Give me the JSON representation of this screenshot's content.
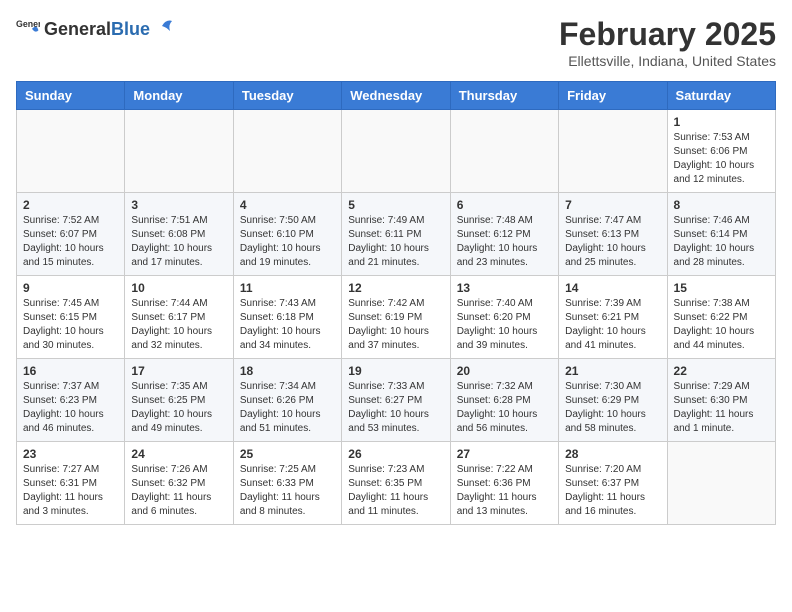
{
  "header": {
    "logo_general": "General",
    "logo_blue": "Blue",
    "title": "February 2025",
    "location": "Ellettsville, Indiana, United States"
  },
  "weekdays": [
    "Sunday",
    "Monday",
    "Tuesday",
    "Wednesday",
    "Thursday",
    "Friday",
    "Saturday"
  ],
  "weeks": [
    [
      {
        "day": "",
        "info": ""
      },
      {
        "day": "",
        "info": ""
      },
      {
        "day": "",
        "info": ""
      },
      {
        "day": "",
        "info": ""
      },
      {
        "day": "",
        "info": ""
      },
      {
        "day": "",
        "info": ""
      },
      {
        "day": "1",
        "info": "Sunrise: 7:53 AM\nSunset: 6:06 PM\nDaylight: 10 hours\nand 12 minutes."
      }
    ],
    [
      {
        "day": "2",
        "info": "Sunrise: 7:52 AM\nSunset: 6:07 PM\nDaylight: 10 hours\nand 15 minutes."
      },
      {
        "day": "3",
        "info": "Sunrise: 7:51 AM\nSunset: 6:08 PM\nDaylight: 10 hours\nand 17 minutes."
      },
      {
        "day": "4",
        "info": "Sunrise: 7:50 AM\nSunset: 6:10 PM\nDaylight: 10 hours\nand 19 minutes."
      },
      {
        "day": "5",
        "info": "Sunrise: 7:49 AM\nSunset: 6:11 PM\nDaylight: 10 hours\nand 21 minutes."
      },
      {
        "day": "6",
        "info": "Sunrise: 7:48 AM\nSunset: 6:12 PM\nDaylight: 10 hours\nand 23 minutes."
      },
      {
        "day": "7",
        "info": "Sunrise: 7:47 AM\nSunset: 6:13 PM\nDaylight: 10 hours\nand 25 minutes."
      },
      {
        "day": "8",
        "info": "Sunrise: 7:46 AM\nSunset: 6:14 PM\nDaylight: 10 hours\nand 28 minutes."
      }
    ],
    [
      {
        "day": "9",
        "info": "Sunrise: 7:45 AM\nSunset: 6:15 PM\nDaylight: 10 hours\nand 30 minutes."
      },
      {
        "day": "10",
        "info": "Sunrise: 7:44 AM\nSunset: 6:17 PM\nDaylight: 10 hours\nand 32 minutes."
      },
      {
        "day": "11",
        "info": "Sunrise: 7:43 AM\nSunset: 6:18 PM\nDaylight: 10 hours\nand 34 minutes."
      },
      {
        "day": "12",
        "info": "Sunrise: 7:42 AM\nSunset: 6:19 PM\nDaylight: 10 hours\nand 37 minutes."
      },
      {
        "day": "13",
        "info": "Sunrise: 7:40 AM\nSunset: 6:20 PM\nDaylight: 10 hours\nand 39 minutes."
      },
      {
        "day": "14",
        "info": "Sunrise: 7:39 AM\nSunset: 6:21 PM\nDaylight: 10 hours\nand 41 minutes."
      },
      {
        "day": "15",
        "info": "Sunrise: 7:38 AM\nSunset: 6:22 PM\nDaylight: 10 hours\nand 44 minutes."
      }
    ],
    [
      {
        "day": "16",
        "info": "Sunrise: 7:37 AM\nSunset: 6:23 PM\nDaylight: 10 hours\nand 46 minutes."
      },
      {
        "day": "17",
        "info": "Sunrise: 7:35 AM\nSunset: 6:25 PM\nDaylight: 10 hours\nand 49 minutes."
      },
      {
        "day": "18",
        "info": "Sunrise: 7:34 AM\nSunset: 6:26 PM\nDaylight: 10 hours\nand 51 minutes."
      },
      {
        "day": "19",
        "info": "Sunrise: 7:33 AM\nSunset: 6:27 PM\nDaylight: 10 hours\nand 53 minutes."
      },
      {
        "day": "20",
        "info": "Sunrise: 7:32 AM\nSunset: 6:28 PM\nDaylight: 10 hours\nand 56 minutes."
      },
      {
        "day": "21",
        "info": "Sunrise: 7:30 AM\nSunset: 6:29 PM\nDaylight: 10 hours\nand 58 minutes."
      },
      {
        "day": "22",
        "info": "Sunrise: 7:29 AM\nSunset: 6:30 PM\nDaylight: 11 hours\nand 1 minute."
      }
    ],
    [
      {
        "day": "23",
        "info": "Sunrise: 7:27 AM\nSunset: 6:31 PM\nDaylight: 11 hours\nand 3 minutes."
      },
      {
        "day": "24",
        "info": "Sunrise: 7:26 AM\nSunset: 6:32 PM\nDaylight: 11 hours\nand 6 minutes."
      },
      {
        "day": "25",
        "info": "Sunrise: 7:25 AM\nSunset: 6:33 PM\nDaylight: 11 hours\nand 8 minutes."
      },
      {
        "day": "26",
        "info": "Sunrise: 7:23 AM\nSunset: 6:35 PM\nDaylight: 11 hours\nand 11 minutes."
      },
      {
        "day": "27",
        "info": "Sunrise: 7:22 AM\nSunset: 6:36 PM\nDaylight: 11 hours\nand 13 minutes."
      },
      {
        "day": "28",
        "info": "Sunrise: 7:20 AM\nSunset: 6:37 PM\nDaylight: 11 hours\nand 16 minutes."
      },
      {
        "day": "",
        "info": ""
      }
    ]
  ]
}
